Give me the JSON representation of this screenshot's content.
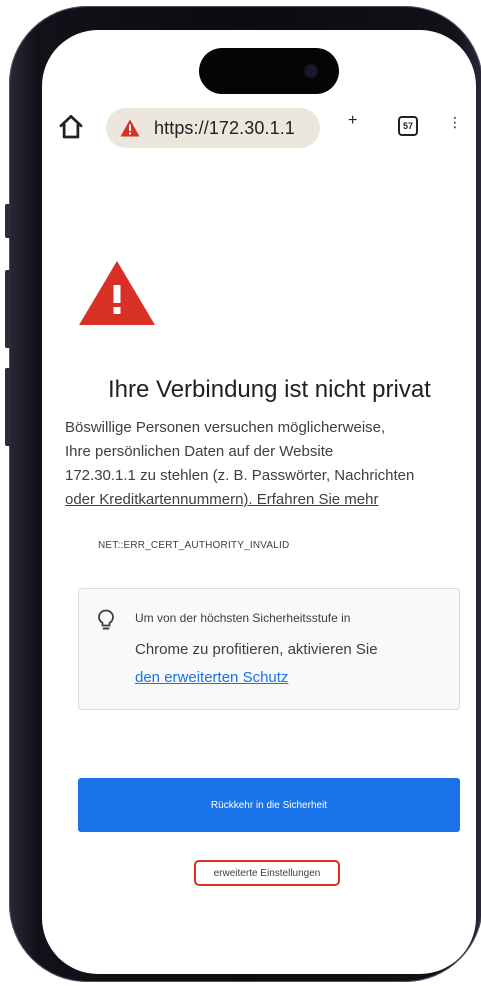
{
  "browser": {
    "url": "https://172.30.1.1",
    "new_tab_symbol": "+",
    "tab_count": "57",
    "menu_symbol": "⋮",
    "icons": [
      "home-icon",
      "not-secure-warning-icon",
      "plus-icon",
      "tab-switcher-icon",
      "overflow-menu-icon"
    ]
  },
  "interstitial": {
    "title": "Ihre Verbindung ist nicht privat",
    "description_lines": [
      "Böswillige Personen versuchen möglicherweise,",
      "Ihre persönlichen Daten auf der Website",
      "172.30.1.1 zu stehlen (z. B. Passwörter, Nachrichten",
      "oder Kreditkartennummern). Erfahren Sie mehr"
    ],
    "error_code": "NET::ERR_CERT_AUTHORITY_INVALID",
    "tip": {
      "line1": "Um von der höchsten Sicherheitsstufe in",
      "line2": "Chrome zu profitieren, aktivieren Sie",
      "line3": "den erweiterten Schutz"
    },
    "back_button": "Rückkehr in die Sicherheit",
    "advanced_button": "erweiterte Einstellungen"
  },
  "colors": {
    "warning_red": "#d93025",
    "primary_blue": "#1a73e8",
    "omnibox_bg": "#ece6dc",
    "text": "#3c4043",
    "advanced_button_outline": "#d93025"
  }
}
